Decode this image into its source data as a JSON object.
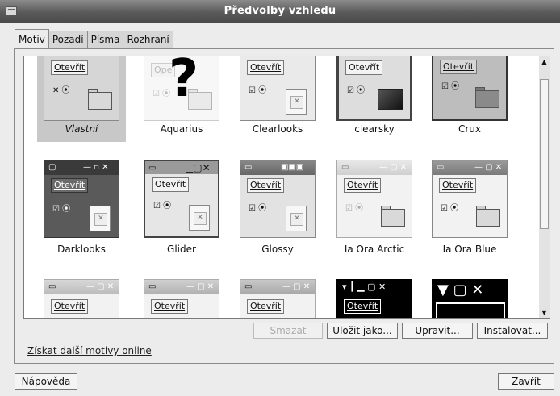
{
  "window": {
    "title": "Předvolby vzhledu"
  },
  "tabs": [
    {
      "label": "Motiv",
      "active": true
    },
    {
      "label": "Pozadí",
      "active": false
    },
    {
      "label": "Písma",
      "active": false
    },
    {
      "label": "Rozhraní",
      "active": false
    }
  ],
  "preview_text": {
    "open_button": "Otevřít",
    "aquarius_overlay": "?",
    "aquarius_btn_partial": "Ope"
  },
  "themes": [
    {
      "name": "Vlastní",
      "selected": true
    },
    {
      "name": "Aquarius",
      "selected": false
    },
    {
      "name": "Clearlooks",
      "selected": false
    },
    {
      "name": "clearsky",
      "selected": false
    },
    {
      "name": "Crux",
      "selected": false
    },
    {
      "name": "Darklooks",
      "selected": false
    },
    {
      "name": "Glider",
      "selected": false
    },
    {
      "name": "Glossy",
      "selected": false
    },
    {
      "name": "Ia Ora Arctic",
      "selected": false
    },
    {
      "name": "Ia Ora Blue",
      "selected": false
    },
    {
      "name": "",
      "selected": false
    },
    {
      "name": "",
      "selected": false
    },
    {
      "name": "",
      "selected": false
    },
    {
      "name": "",
      "selected": false
    },
    {
      "name": "",
      "selected": false
    }
  ],
  "actions": {
    "delete": "Smazat",
    "save_as": "Uložit jako...",
    "edit": "Upravit...",
    "install": "Instalovat..."
  },
  "online_link": "Získat další motivy online",
  "footer": {
    "help": "Nápověda",
    "close": "Zavřít"
  }
}
